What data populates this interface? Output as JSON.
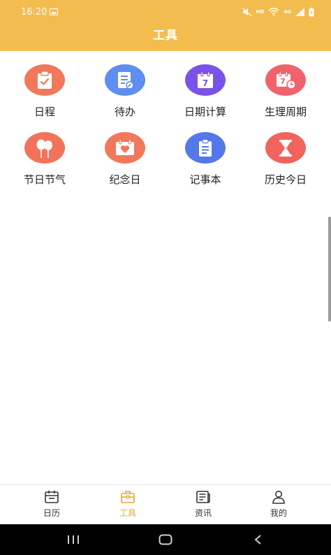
{
  "status_bar": {
    "time": "16:20",
    "hd": "HD",
    "network": "4G"
  },
  "header": {
    "title": "工具"
  },
  "tools": [
    {
      "label": "日程",
      "icon": "clipboard-check-icon",
      "color": "#f2785c"
    },
    {
      "label": "待办",
      "icon": "note-edit-icon",
      "color": "#5f8df0"
    },
    {
      "label": "日期计算",
      "icon": "calendar-7-icon",
      "color": "#7b52e8"
    },
    {
      "label": "生理周期",
      "icon": "calendar-clock-icon",
      "color": "#f1636c"
    },
    {
      "label": "节日节气",
      "icon": "balloons-icon",
      "color": "#f1735c"
    },
    {
      "label": "纪念日",
      "icon": "heart-calendar-icon",
      "color": "#f2785c"
    },
    {
      "label": "记事本",
      "icon": "notepad-icon",
      "color": "#5477ea"
    },
    {
      "label": "历史今日",
      "icon": "hourglass-icon",
      "color": "#f1635c"
    }
  ],
  "tabbar": {
    "calendar": "日历",
    "tools": "工具",
    "news": "资讯",
    "mine": "我的",
    "active": "tools",
    "accent": "#e7a53a"
  }
}
